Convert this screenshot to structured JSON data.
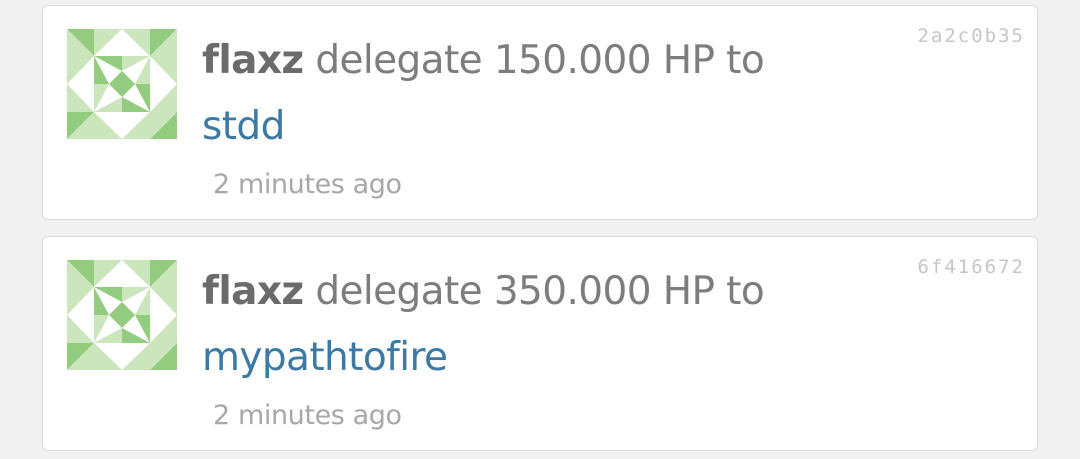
{
  "colors": {
    "page_background": "#f1f1f1",
    "card_background": "#ffffff",
    "username": "#6b6b6b",
    "text": "#7d7d7d",
    "link": "#3c7aa6",
    "timestamp": "#a8a8a8",
    "hash": "#c6c6c6",
    "avatar_dark": "#94cc7f",
    "avatar_light": "#cbe6bd"
  },
  "operations": [
    {
      "avatar_icon": "identicon-avatar",
      "user": "flaxz",
      "action": "delegate 150.000 HP to",
      "target": "stdd",
      "time": "2 minutes ago",
      "hash": "2a2c0b35"
    },
    {
      "avatar_icon": "identicon-avatar",
      "user": "flaxz",
      "action": "delegate 350.000 HP to",
      "target": "mypathtofire",
      "time": "2 minutes ago",
      "hash": "6f416672"
    }
  ]
}
